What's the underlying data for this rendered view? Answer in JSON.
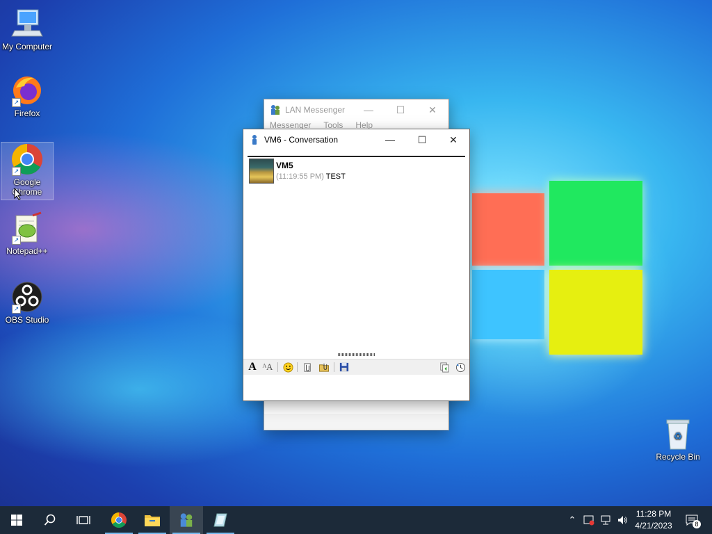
{
  "desktop": {
    "icons": [
      {
        "label": "My Computer"
      },
      {
        "label": "Firefox"
      },
      {
        "label": "Google Chrome"
      },
      {
        "label": "Notepad++"
      },
      {
        "label": "OBS Studio"
      },
      {
        "label": "Recycle Bin"
      }
    ]
  },
  "messenger_window": {
    "title": "LAN Messenger",
    "menu": [
      "Messenger",
      "Tools",
      "Help"
    ]
  },
  "conversation_window": {
    "title": "VM6 - Conversation",
    "messages": [
      {
        "sender": "VM5",
        "time": "(11:19:55 PM)",
        "text": "TEST"
      }
    ],
    "toolbar_icons": [
      "font-icon",
      "font-style-icon",
      "smiley-icon",
      "attach-file-icon",
      "attach-folder-icon",
      "save-icon",
      "copy-history-icon",
      "history-icon"
    ]
  },
  "taskbar": {
    "clock_time": "11:28 PM",
    "clock_date": "4/21/2023",
    "notification_count": "8"
  },
  "colors": {
    "taskbar": "#1c2a39",
    "accent": "#76b9ed"
  }
}
